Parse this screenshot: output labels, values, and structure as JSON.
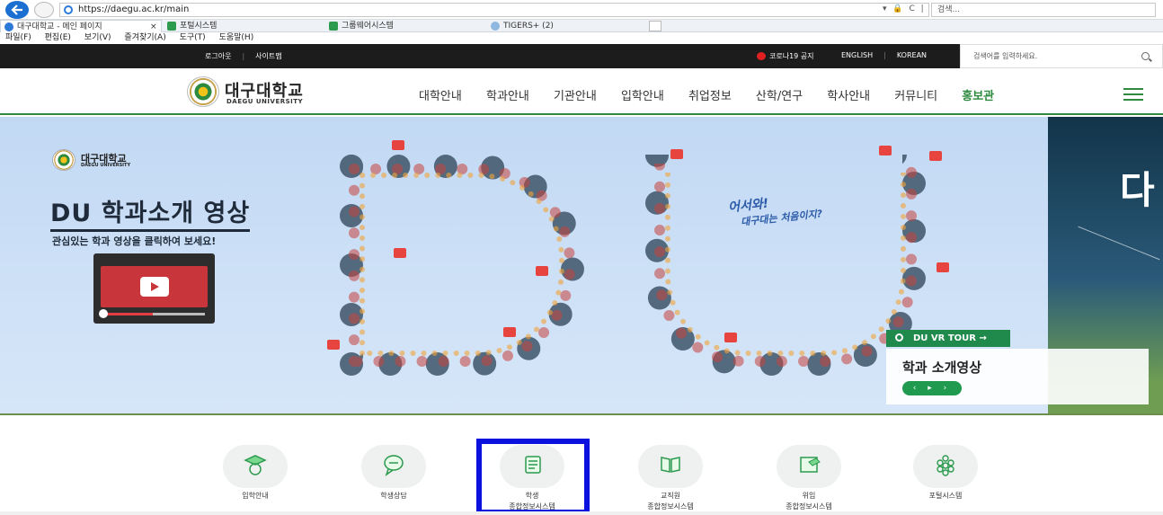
{
  "browser": {
    "url": "https://daegu.ac.kr/main",
    "url_controls": "▾ 🔒 C |",
    "search_placeholder": "검색...",
    "tabs": [
      {
        "label": "대구대학교 - 메인 페이지",
        "close": "×"
      },
      {
        "label": "포털시스템"
      },
      {
        "label": "그룹웨어시스템"
      },
      {
        "label": "TIGERS+ (2)"
      }
    ],
    "menu": [
      "파일(F)",
      "편집(E)",
      "보기(V)",
      "즐겨찾기(A)",
      "도구(T)",
      "도움말(H)"
    ]
  },
  "topbar": {
    "logout": "로그아웃",
    "sitemap": "사이트맵",
    "covid": "코로나19 공지",
    "english": "ENGLISH",
    "korean": "KOREAN",
    "search_placeholder": "검색어를 입력하세요."
  },
  "header": {
    "logo_kor": "대구대학교",
    "logo_eng": "DAEGU UNIVERSITY",
    "nav": [
      "대학안내",
      "학과안내",
      "기관안내",
      "입학안내",
      "취업정보",
      "산학/연구",
      "학사안내",
      "커뮤니티",
      "홍보관"
    ]
  },
  "hero": {
    "mini_logo_kor": "대구대학교",
    "mini_logo_eng": "DAEGU UNIVERSITY",
    "title": "DU 학과소개 영상",
    "subtitle": "관심있는 학과 영상을 클릭하여 보세요!",
    "welcome_line1": "어서와!",
    "welcome_line2": "대구대는 처음이지?",
    "vr_tour": "DU VR TOUR →",
    "card_title": "학과 소개영상",
    "card_controls": "‹ ▸ ›",
    "right_partial": "다"
  },
  "quick_links": [
    {
      "line1": "입학안내",
      "line2": ""
    },
    {
      "line1": "학생상담",
      "line2": ""
    },
    {
      "line1": "학생",
      "line2": "종합정보시스템"
    },
    {
      "line1": "교직원",
      "line2": "종합정보시스템"
    },
    {
      "line1": "위임",
      "line2": "종합정보시스템"
    },
    {
      "line1": "포털시스템",
      "line2": ""
    }
  ],
  "colors": {
    "brand_green": "#2d8a3e",
    "highlight_box": "#0b12e0"
  }
}
